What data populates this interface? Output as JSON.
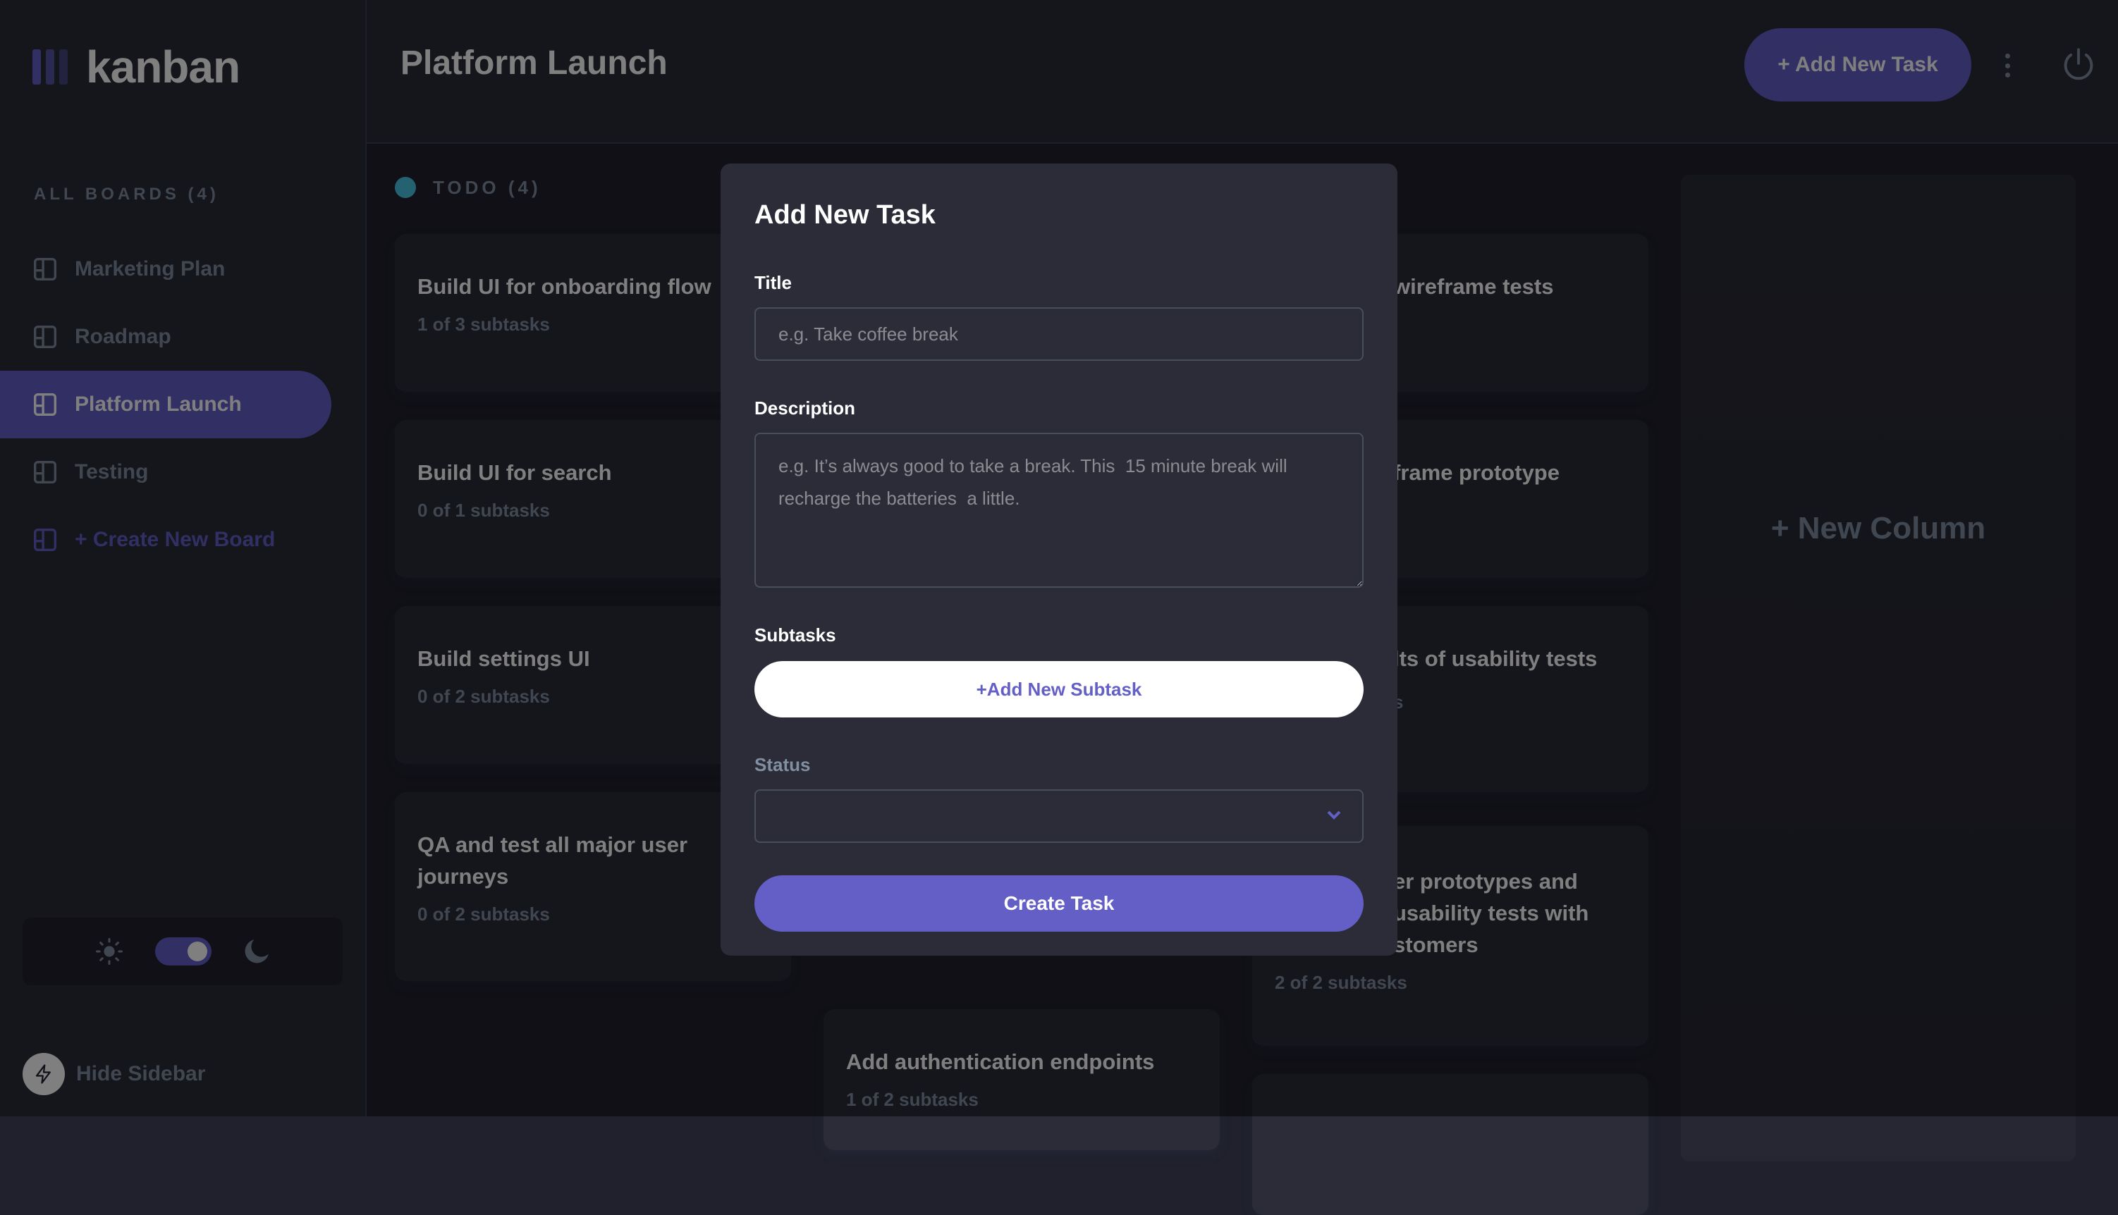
{
  "app": {
    "logo_text": "kanban"
  },
  "sidebar": {
    "all_boards_label": "ALL BOARDS (4)",
    "boards": [
      {
        "label": "Marketing Plan",
        "active": false
      },
      {
        "label": "Roadmap",
        "active": false
      },
      {
        "label": "Platform Launch",
        "active": true
      },
      {
        "label": "Testing",
        "active": false
      }
    ],
    "create_board_label": "+ Create New Board",
    "theme": {
      "light_icon": "sun-icon",
      "dark_icon": "moon-icon",
      "dark_mode": true
    },
    "hide_sidebar_label": "Hide Sidebar"
  },
  "header": {
    "title": "Platform Launch",
    "add_task_label": "+ Add New Task",
    "menu_icon": "vertical-ellipsis-icon",
    "power_icon": "power-icon"
  },
  "board": {
    "columns": [
      {
        "name": "TODO (4)",
        "color": "#49c4e5",
        "cards": [
          {
            "title": "Build UI for onboarding flow",
            "subtasks": "1 of 3 subtasks"
          },
          {
            "title": "Build UI for search",
            "subtasks": "0 of 1 subtasks"
          },
          {
            "title": "Build settings UI",
            "subtasks": "0 of 2 subtasks"
          },
          {
            "title": "QA and test all major user journeys",
            "subtasks": "0 of 2 subtasks"
          }
        ]
      },
      {
        "cards": [
          {
            "title": "Add authentication endpoints",
            "subtasks": "1 of 2 subtasks"
          }
        ]
      },
      {
        "cards": [
          {
            "title": "wireframe tests",
            "subtasks": ""
          },
          {
            "title": "frame prototype",
            "subtasks": ""
          },
          {
            "title": "lts of usability tests",
            "subtasks": "s"
          },
          {
            "title": "er prototypes and\nusability tests with\nstomers",
            "subtasks": "2 of 2 subtasks"
          }
        ]
      }
    ],
    "new_column_label": "+ New Column"
  },
  "modal": {
    "title": "Add New Task",
    "title_label": "Title",
    "title_placeholder": "e.g. Take coffee break",
    "description_label": "Description",
    "description_placeholder": "e.g. It’s always good to take a break. This  15 minute break will recharge the batteries  a little.",
    "subtasks_label": "Subtasks",
    "add_subtask_label": "+Add New Subtask",
    "status_label": "Status",
    "status_value": "",
    "create_label": "Create Task"
  },
  "colors": {
    "accent": "#635fc7",
    "background": "#20212c",
    "surface": "#2b2c37",
    "muted_text": "#828fa3"
  }
}
